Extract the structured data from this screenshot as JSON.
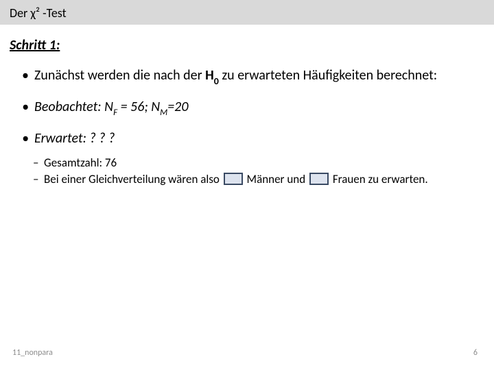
{
  "title": "Der χ² -Test",
  "step_label": "Schritt 1:",
  "bullets": {
    "b1_pre": "Zunächst werden die nach der ",
    "b1_h0": "H",
    "b1_h0sub": "0",
    "b1_post": " zu erwarteten Häufigkeiten berechnet:",
    "b2_pre": "Beobachtet: N",
    "b2_fsub": "F",
    "b2_mid": " = 56; N",
    "b2_msub": "M",
    "b2_post": "=20",
    "b3": "Erwartet: ? ? ?"
  },
  "sub": {
    "s1": "Gesamtzahl: 76",
    "s2_a": "Bei einer Gleichverteilung wären also ",
    "s2_b": " Männer und ",
    "s2_c": " Frauen zu erwarten."
  },
  "footer": {
    "left": "11_nonpara",
    "right": "6"
  }
}
